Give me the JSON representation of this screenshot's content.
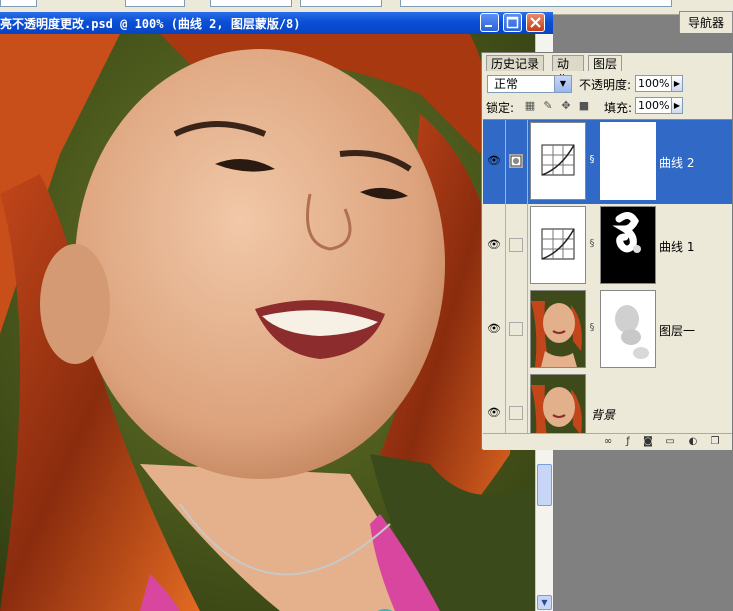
{
  "document": {
    "title": "亮不透明度更改.psd @ 100% (曲线 2, 图层蒙版/8)"
  },
  "navigator_tab": "导航器",
  "layers_panel": {
    "tabs": [
      "历史记录",
      "动作",
      "图层"
    ],
    "active_tab": "图层",
    "blend_mode": "正常",
    "opacity_label": "不透明度:",
    "opacity_value": "100%",
    "lock_label": "锁定:",
    "fill_label": "填充:",
    "fill_value": "100%",
    "layers": [
      {
        "name": "曲线 2",
        "visible": true,
        "selected": true,
        "type": "adjustment",
        "mask": "white"
      },
      {
        "name": "曲线 1",
        "visible": true,
        "selected": false,
        "type": "adjustment",
        "mask": "black-with-white-shapes"
      },
      {
        "name": "图层一",
        "visible": true,
        "selected": false,
        "type": "image",
        "mask": "white-with-gray-shapes"
      },
      {
        "name": "背景",
        "visible": true,
        "selected": false,
        "type": "background",
        "mask": "none"
      }
    ],
    "bottom_icons": [
      "link-icon",
      "layer-style-icon",
      "add-mask-icon",
      "new-set-icon",
      "new-adjustment-layer-icon",
      "new-layer-icon"
    ]
  },
  "colors": {
    "title_bar": "#0a4fd6",
    "selected_layer": "#3169c6",
    "panel_bg": "#ece9d8"
  }
}
